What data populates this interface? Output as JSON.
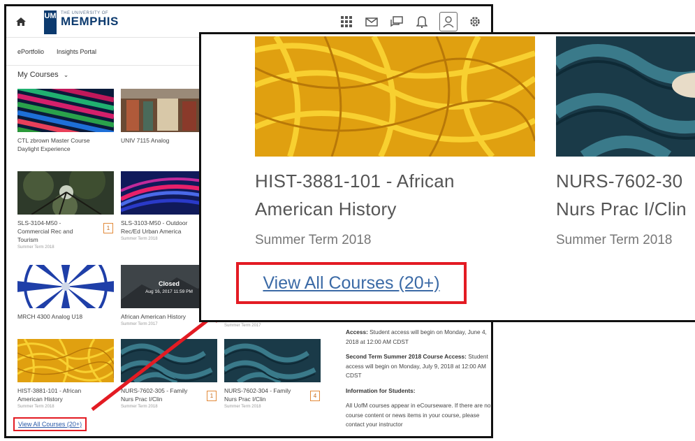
{
  "header": {
    "logo_mark": "UM",
    "logo_small": "THE UNIVERSITY OF",
    "logo_big": "MEMPHIS",
    "icons": [
      "home-icon",
      "grid-icon",
      "mail-icon",
      "chat-icon",
      "bell-icon",
      "avatar-icon",
      "gear-icon"
    ]
  },
  "nav": {
    "items": [
      "ePortfolio",
      "Insights Portal"
    ]
  },
  "my_courses": {
    "label": "My Courses",
    "chevron": "⌄"
  },
  "tiles": [
    {
      "name": "CTL zbrown Master Course Daylight Experience",
      "term": ""
    },
    {
      "name": "UNIV 7115 Analog",
      "term": ""
    },
    {
      "name": "SLS-3104-M50 - Commercial Rec and Tourism",
      "term": "Summer Term 2018",
      "badge": "1"
    },
    {
      "name": "SLS-3103-M50 - Outdoor Rec/Ed Urban America",
      "term": "Summer Term 2018"
    },
    {
      "name": "MRCH 4300 Analog U18",
      "term": ""
    },
    {
      "name": "African American History",
      "term": "Summer Term 2017",
      "overlay_title": "Closed",
      "overlay_date": "Aug 16, 2017 11:59 PM"
    },
    {
      "name": "HIST-3881-101 - African American History",
      "term": "Summer Term 2018"
    },
    {
      "name": "NURS-7602-305 - Family Nurs Prac I/Clin",
      "term": "Summer Term 2018",
      "badge": "1"
    },
    {
      "name": "NURS-7602-304 - Family Nurs Prac I/Clin",
      "term": "Summer Term 2018",
      "badge": "4"
    }
  ],
  "partial_term": "Summer Term 2017",
  "view_all_small": "View All Courses (20+)",
  "notes": {
    "p1_label": "Access:",
    "p1_text": " Student access will begin on Monday, June 4, 2018 at 12:00 AM CDST",
    "p2_label": "Second Term Summer 2018 Course Access:",
    "p2_text": " Student access will begin on Monday, July 9, 2018 at 12:00 AM CDST",
    "p3_label": "Information for Students:",
    "p4_text": "All UofM courses appear in eCourseware. If there are no course content or news items in your course, please contact your instructor"
  },
  "zoom": {
    "title1_line1": "HIST-3881-101 - African",
    "title1_line2": "American History",
    "term1": "Summer Term 2018",
    "title2_line1": "NURS-7602-30",
    "title2_line2": "Nurs Prac I/Clin",
    "term2": "Summer Term 2018",
    "view_all": "View All Courses (20+)"
  },
  "colors": {
    "highlight": "#e31b23",
    "link": "#3b6aa6",
    "brand": "#0c3a6e",
    "badge": "#e28a3a"
  }
}
